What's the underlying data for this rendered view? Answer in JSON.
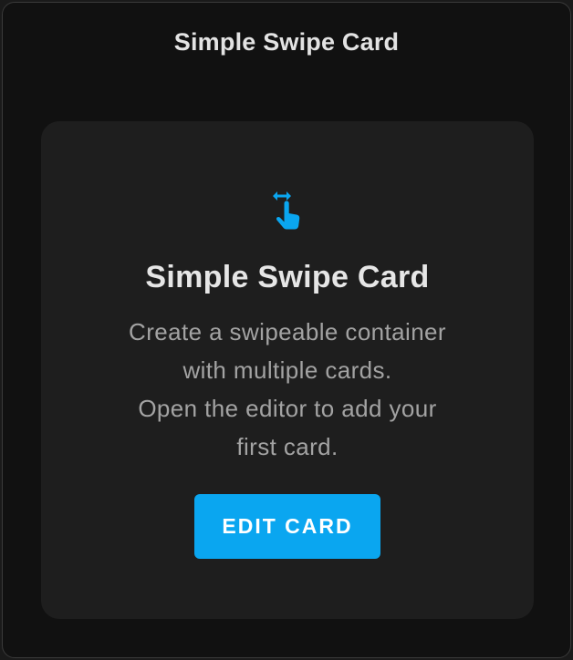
{
  "header": {
    "title": "Simple Swipe Card"
  },
  "card": {
    "icon": "swipe-horizontal-hand-icon",
    "title": "Simple Swipe Card",
    "description_lines": [
      "Create a swipeable container",
      "with multiple cards.",
      "Open the editor to add your",
      "first card."
    ],
    "button_label": "EDIT CARD"
  },
  "colors": {
    "accent": "#0aa6f0",
    "background": "#111111",
    "card_background": "#1e1e1e",
    "title_text": "#e6e6e6",
    "body_text": "#a3a3a3"
  }
}
